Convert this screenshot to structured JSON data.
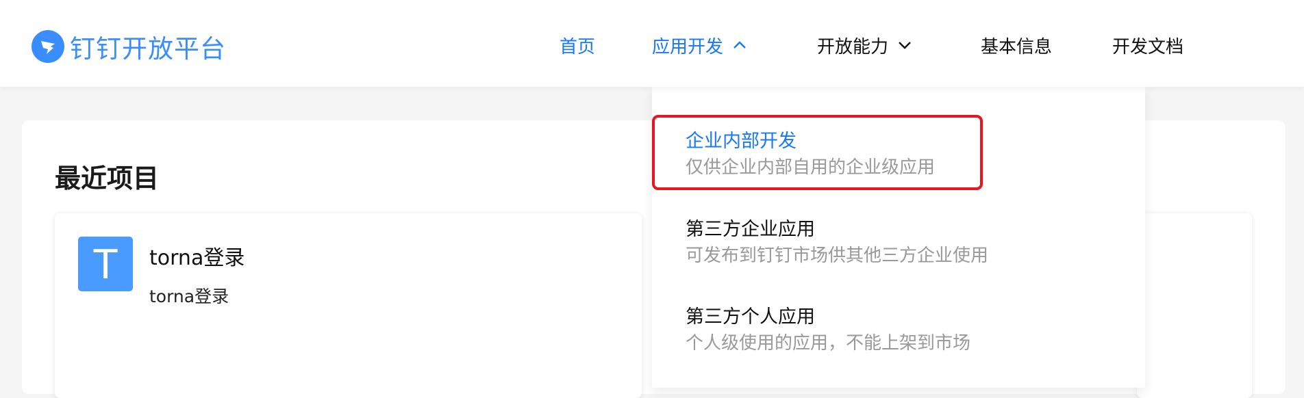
{
  "header": {
    "brand": "钉钉开放平台",
    "brand_color": "#3a8dff",
    "logo_icon": "dingtalk-logo-icon",
    "nav": [
      {
        "label": "首页",
        "active": true
      },
      {
        "label": "应用开发",
        "active": true,
        "icon": "chevron-up-icon"
      },
      {
        "label": "开放能力",
        "active": false,
        "icon": "chevron-down-icon"
      },
      {
        "label": "基本信息",
        "active": false
      },
      {
        "label": "开发文档",
        "active": false
      }
    ],
    "accent_color": "#1677ff"
  },
  "dropdown": {
    "items": [
      {
        "title": "企业内部开发",
        "desc": "仅供企业内部自用的企业级应用",
        "selected": true
      },
      {
        "title": "第三方企业应用",
        "desc": "可发布到钉钉市场供其他三方企业使用",
        "selected": false
      },
      {
        "title": "第三方个人应用",
        "desc": "个人级使用的应用，不能上架到市场",
        "selected": false
      }
    ],
    "highlight_color": "#e8141f"
  },
  "main": {
    "section_title": "最近项目",
    "projects": [
      {
        "avatar_letter": "T",
        "name": "torna登录",
        "desc": "torna登录",
        "avatar_color": "#4a9bff"
      }
    ]
  }
}
